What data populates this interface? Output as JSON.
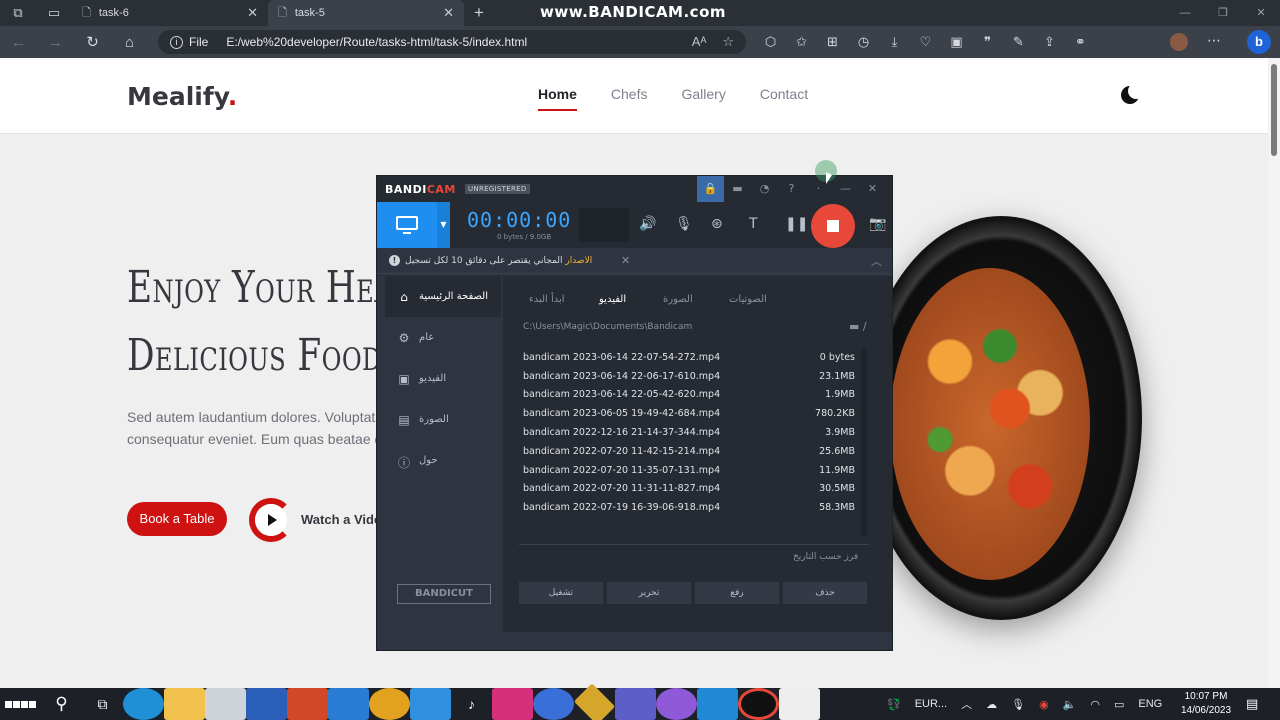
{
  "browser": {
    "tabs": [
      {
        "label": "task-6"
      },
      {
        "label": "task-5"
      }
    ],
    "new_tab": "+",
    "watermark": "www.BANDICAM.com",
    "address": {
      "protocol_label": "File",
      "url": "E:/web%20developer/Route/tasks-html/task-5/index.html"
    }
  },
  "site": {
    "logo": "Mealify",
    "logo_dot": ".",
    "nav": [
      "Home",
      "Chefs",
      "Gallery",
      "Contact"
    ],
    "hero_title_line1": "Enjoy Your Healt",
    "hero_title_line2": "Delicious Food",
    "hero_text_line1": "Sed autem laudantium dolores. Voluptat",
    "hero_text_line2": "consequatur eveniet. Eum quas beatae d",
    "book_button": "Book a Table",
    "watch_video": "Watch a Vide"
  },
  "bandicam": {
    "logo_band": "BANDI",
    "logo_cam": "CAM",
    "unregistered": "UNREGISTERED",
    "timer": "00:00:00",
    "size_info": "0 bytes / 9.0GB",
    "notice_prefix": "الاصدار",
    "notice_body": "المجاني يقتصر على دقائق 10 لكل تسجيل",
    "sidebar": [
      "الصفحة الرئيسية",
      "عام",
      "الفيديو",
      "الصورة",
      "حول"
    ],
    "tabs": [
      "ابدأ البدء",
      "الفيديو",
      "الصورة",
      "الصوتيات"
    ],
    "path": "C:\\Users\\Magic\\Documents\\Bandicam",
    "files": [
      {
        "name": "bandicam 2023-06-14 22-07-54-272.mp4",
        "size": "0 bytes"
      },
      {
        "name": "bandicam 2023-06-14 22-06-17-610.mp4",
        "size": "23.1MB"
      },
      {
        "name": "bandicam 2023-06-14 22-05-42-620.mp4",
        "size": "1.9MB"
      },
      {
        "name": "bandicam 2023-06-05 19-49-42-684.mp4",
        "size": "780.2KB"
      },
      {
        "name": "bandicam 2022-12-16 21-14-37-344.mp4",
        "size": "3.9MB"
      },
      {
        "name": "bandicam 2022-07-20 11-42-15-214.mp4",
        "size": "25.6MB"
      },
      {
        "name": "bandicam 2022-07-20 11-35-07-131.mp4",
        "size": "11.9MB"
      },
      {
        "name": "bandicam 2022-07-20 11-31-11-827.mp4",
        "size": "30.5MB"
      },
      {
        "name": "bandicam 2022-07-19 16-39-06-918.mp4",
        "size": "58.3MB"
      }
    ],
    "sort_label": "فرز حسب التاريخ",
    "actions": [
      "تشغيل",
      "تحرير",
      "رفع",
      "حذف"
    ],
    "bandicut": "BANDICUT"
  },
  "taskbar": {
    "currency": "EUR...",
    "language": "ENG",
    "time": "10:07 PM",
    "date": "14/06/2023"
  },
  "colors": {
    "brand_red": "#ce1212",
    "bandicam_blue": "#1e8ff0",
    "rec_red": "#e8483a"
  }
}
